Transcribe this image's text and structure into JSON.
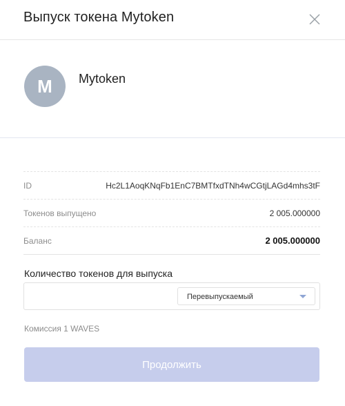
{
  "dialog": {
    "title": "Выпуск токена Mytoken"
  },
  "token": {
    "avatar_letter": "M",
    "name": "Mytoken"
  },
  "info": {
    "rows": [
      {
        "label": "ID",
        "value": "Hc2L1AoqKNqFb1EnC7BMTfxdTNh4wCGtjLAGd4mhs3tF"
      },
      {
        "label": "Токенов выпущено",
        "value": "2 005.000000"
      },
      {
        "label": "Баланс",
        "value": "2 005.000000"
      }
    ]
  },
  "form": {
    "amount_label": "Количество токенов для выпуска",
    "amount_value": "",
    "reissue_select": "Перевыпускаемый",
    "fee_text": "Комиссия 1 WAVES",
    "continue_label": "Продолжить"
  },
  "colors": {
    "avatar_bg": "#a9b4c2",
    "button_disabled_bg": "#c6cdec",
    "select_arrow": "#8fa5d4"
  },
  "icons": {
    "close": "close-icon",
    "dropdown": "chevron-down-icon"
  }
}
